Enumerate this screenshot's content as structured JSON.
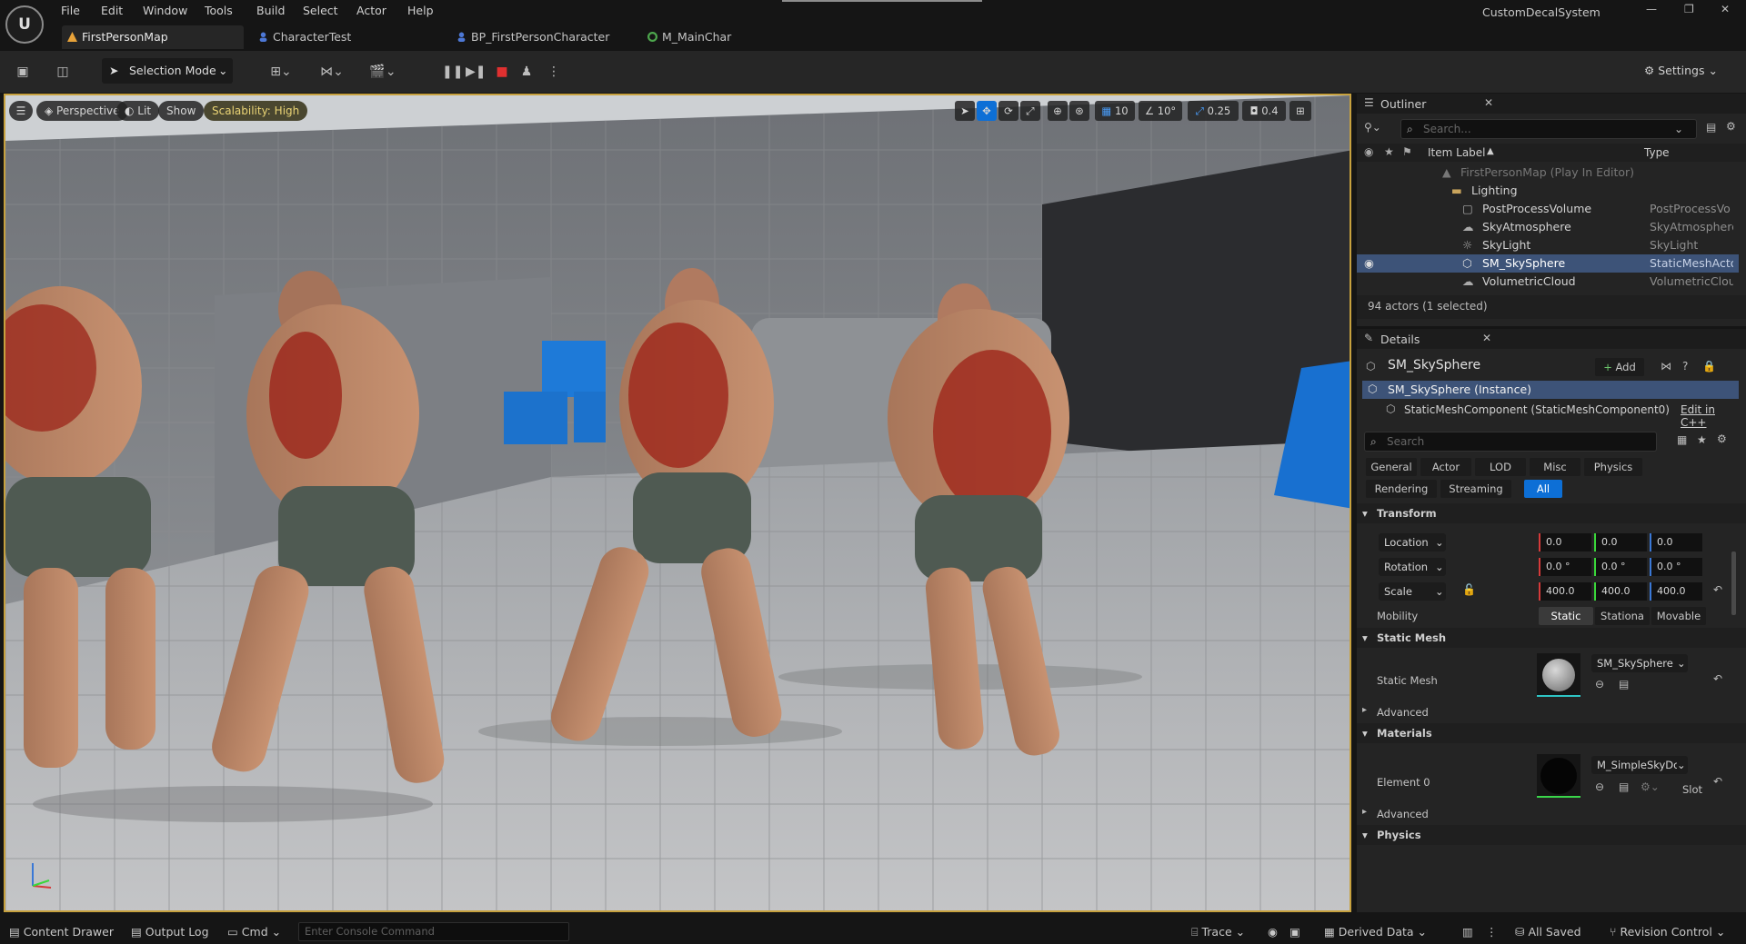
{
  "menu": [
    "File",
    "Edit",
    "Window",
    "Tools",
    "Build",
    "Select",
    "Actor",
    "Help"
  ],
  "project_name": "CustomDecalSystem",
  "tabs": [
    {
      "label": "FirstPersonMap",
      "color": "#e8a33a"
    },
    {
      "label": "CharacterTest",
      "color": "#4d78d6"
    },
    {
      "label": "BP_FirstPersonCharacter",
      "color": "#4d78d6"
    },
    {
      "label": "M_MainChar",
      "color": "#4da64d"
    }
  ],
  "toolbar": {
    "selection_mode": "Selection Mode",
    "settings": "Settings"
  },
  "viewport": {
    "perspective": "Perspective",
    "lit": "Lit",
    "show": "Show",
    "scalability": "Scalability: High",
    "grid_snap": "10",
    "rotation_snap": "10°",
    "scale_snap": "0.25",
    "camera_speed": "0.4"
  },
  "outliner": {
    "title": "Outliner",
    "search_placeholder": "Search...",
    "col_label": "Item Label",
    "col_type": "Type",
    "rows": [
      {
        "label": "FirstPersonMap (Play In Editor)",
        "type": ""
      },
      {
        "label": "Lighting",
        "type": ""
      },
      {
        "label": "PostProcessVolume",
        "type": "PostProcessVo"
      },
      {
        "label": "SkyAtmosphere",
        "type": "SkyAtmosphere"
      },
      {
        "label": "SkyLight",
        "type": "SkyLight"
      },
      {
        "label": "SM_SkySphere",
        "type": "StaticMeshActo"
      },
      {
        "label": "VolumetricCloud",
        "type": "VolumetricClouc"
      }
    ],
    "count": "94 actors (1 selected)"
  },
  "details": {
    "title": "Details",
    "actor_name": "SM_SkySphere",
    "add_label": "Add",
    "instance": "SM_SkySphere (Instance)",
    "component": "StaticMeshComponent (StaticMeshComponent0)",
    "edit_cpp": "Edit in C++",
    "search_placeholder": "Search",
    "filters": [
      "General",
      "Actor",
      "LOD",
      "Misc",
      "Physics",
      "Rendering",
      "Streaming",
      "All"
    ],
    "transform": {
      "section": "Transform",
      "location_label": "Location",
      "rotation_label": "Rotation",
      "scale_label": "Scale",
      "location": [
        "0.0",
        "0.0",
        "0.0"
      ],
      "rotation": [
        "0.0 °",
        "0.0 °",
        "0.0 °"
      ],
      "scale": [
        "400.0",
        "400.0",
        "400.0"
      ],
      "mobility_label": "Mobility",
      "mobility_options": [
        "Static",
        "Stationa",
        "Movable"
      ]
    },
    "static_mesh": {
      "section": "Static Mesh",
      "label": "Static Mesh",
      "value": "SM_SkySphere",
      "advanced": "Advanced"
    },
    "materials": {
      "section": "Materials",
      "element_label": "Element 0",
      "value": "M_SimpleSkyDor",
      "slot": "Slot",
      "advanced": "Advanced"
    },
    "physics_section": "Physics"
  },
  "statusbar": {
    "content_drawer": "Content Drawer",
    "output_log": "Output Log",
    "cmd": "Cmd",
    "console_placeholder": "Enter Console Command",
    "trace": "Trace",
    "derived_data": "Derived Data",
    "all_saved": "All Saved",
    "revision_control": "Revision Control"
  }
}
